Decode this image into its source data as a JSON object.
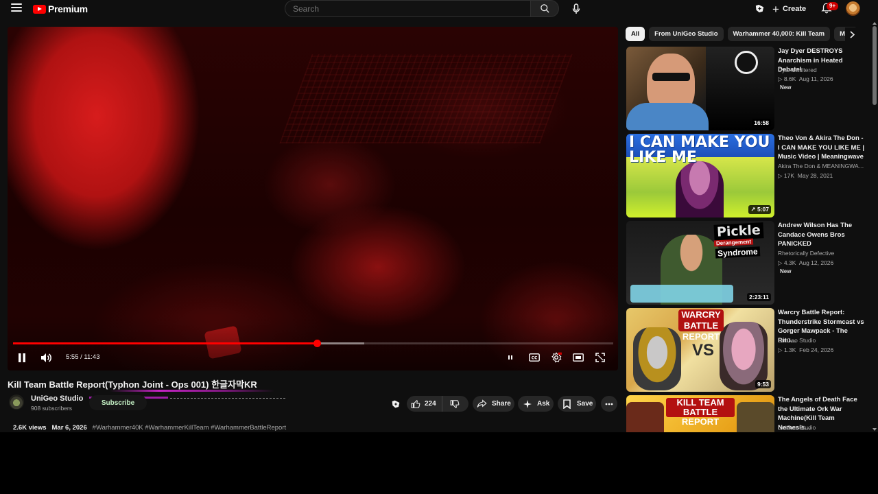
{
  "topbar": {
    "logo_text": "Premium",
    "search_placeholder": "Search",
    "create_label": "Create",
    "notifications_badge": "9+"
  },
  "player": {
    "current_time": "5:55",
    "separator": " / ",
    "duration": "11:43",
    "time_display": "5:55 / 11:43",
    "progress_fraction": 0.5064,
    "buffer_fraction": 0.585,
    "state": "playing"
  },
  "video": {
    "title": "Kill Team Battle Report(Typhon Joint - Ops 001) 한글자막KR",
    "channel_name": "UniGeo Studio",
    "subscribers": "908 subscribers",
    "subscribe_label": "Subscribe",
    "likes": "224",
    "share_label": "Share",
    "ask_label": "Ask",
    "save_label": "Save",
    "views": "2.6K views",
    "date": "Mar 6, 2026",
    "hashtags": "#Warhammer40K #WarhammerKillTeam #WarhammerBattleReport"
  },
  "chips": [
    "All",
    "From UniGeo Studio",
    "Warhammer 40,000: Kill Team",
    "Mini"
  ],
  "recommendations": [
    {
      "title": "Jay Dyer DESTROYS Anarchism in Heated Debate!",
      "channel": "Dyer Unfiltered",
      "views": "8.6K",
      "date": "Aug 11, 2026",
      "badge": "New",
      "duration": "16:58"
    },
    {
      "title": "Theo Von & Akira The Don - I CAN MAKE YOU LIKE ME | Music Video | Meaningwave",
      "channel": "Akira The Don & MEANINGWAVE...",
      "views": "17K",
      "date": "May 28, 2021",
      "badge": "",
      "duration": "5:07",
      "thumb_text": "I CAN MAKE YOU LIKE ME"
    },
    {
      "title": "Andrew Wilson Has The Candace Owens Bros PANICKED",
      "channel": "Rhetorically Defective",
      "views": "4.3K",
      "date": "Aug 12, 2026",
      "badge": "New",
      "duration": "2:23:11",
      "thumb_text_1": "Pickle",
      "thumb_text_2": "Derangement",
      "thumb_text_3": "Syndrome"
    },
    {
      "title": "Warcry Battle Report: Thunderstrike Stormcast vs Gorger Mawpack - The Ritu...",
      "channel": "UniGeo Studio",
      "views": "1.3K",
      "date": "Feb 24, 2026",
      "badge": "",
      "duration": "9:53",
      "thumb_text_1": "WARCRY BATTLE REPORT",
      "thumb_text_2": "VS"
    },
    {
      "title": "The Angels of Death Face the Ultimate Ork War Machine(Kill Team Nemesis...",
      "channel": "UniGeo Studio",
      "views": "",
      "date": "",
      "badge": "",
      "duration": "",
      "thumb_text_1": "KILL TEAM BATTLE REPORT"
    }
  ],
  "colors": {
    "brand_red": "#ff0000",
    "background": "#0f0f0f",
    "pill_bg": "#272727"
  }
}
